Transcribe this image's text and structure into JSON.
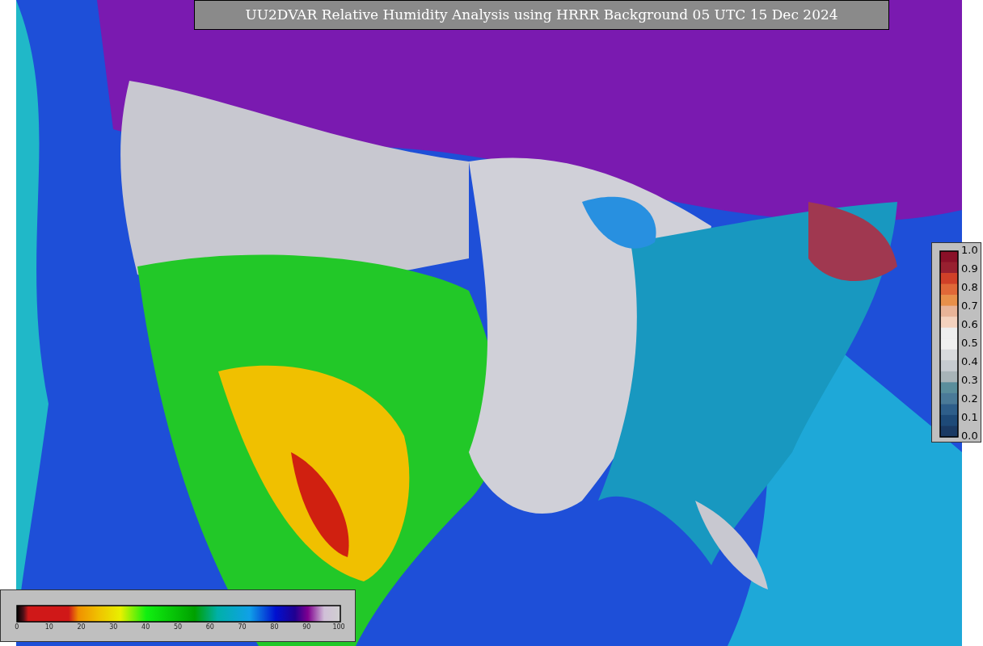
{
  "title": "UU2DVAR Relative Humidity Analysis using HRRR Background 05 UTC 15 Dec 2024",
  "observation_legend": {
    "ticks": [
      "1.0",
      "0.9",
      "0.8",
      "0.7",
      "0.6",
      "0.5",
      "0.4",
      "0.3",
      "0.2",
      "0.1",
      "0.0"
    ]
  },
  "humidity_legend": {
    "ticks": [
      "0",
      "10",
      "20",
      "30",
      "40",
      "50",
      "60",
      "70",
      "80",
      "90",
      "100"
    ]
  }
}
